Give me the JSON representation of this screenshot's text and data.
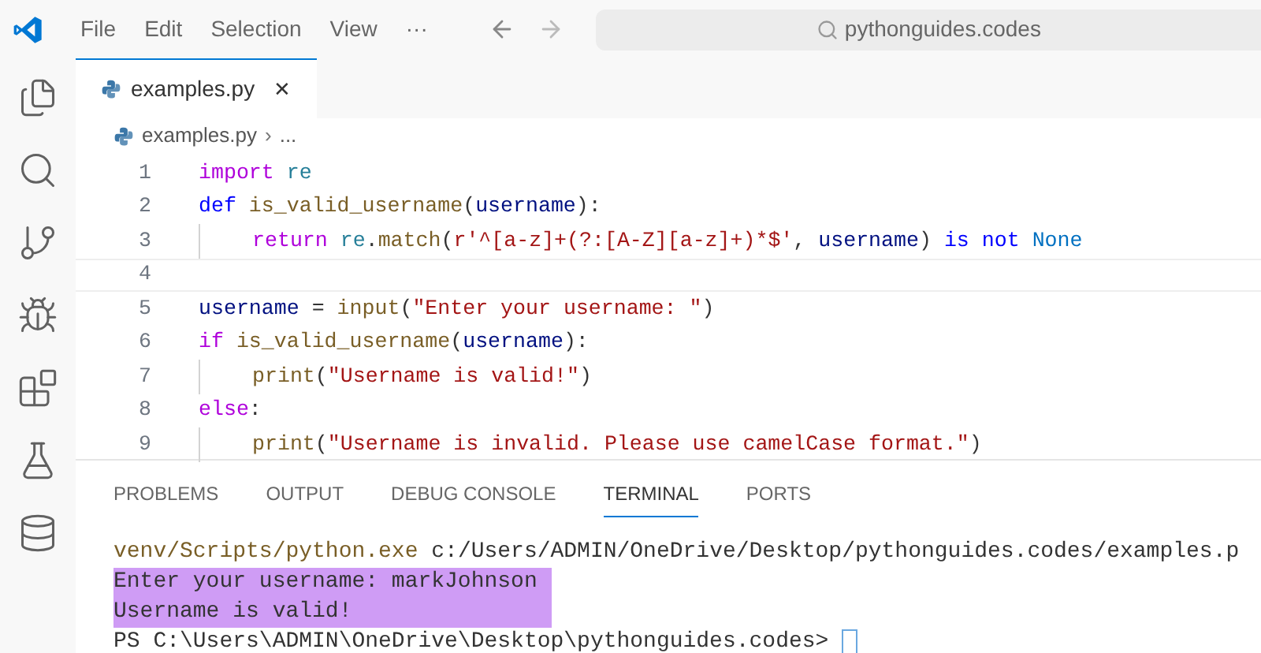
{
  "menu": [
    "File",
    "Edit",
    "Selection",
    "View",
    "···"
  ],
  "search": {
    "value": "pythonguides.codes"
  },
  "tabs": [
    {
      "label": "examples.py",
      "selected": true,
      "close": "✕"
    }
  ],
  "breadcrumb": {
    "file": "examples.py",
    "separator": "›",
    "rest": "..."
  },
  "code_lines": [
    {
      "number": "1",
      "indent": false,
      "current": false,
      "tokens": [
        {
          "kind": "control",
          "text": "import"
        },
        {
          "kind": "module",
          "text": " re"
        }
      ]
    },
    {
      "number": "2",
      "indent": false,
      "current": false,
      "tokens": [
        {
          "kind": "keyword",
          "text": "def"
        },
        {
          "kind": "function",
          "text": " is_valid_username"
        },
        {
          "kind": "plain",
          "text": "("
        },
        {
          "kind": "variable",
          "text": "username"
        },
        {
          "kind": "plain",
          "text": "):"
        }
      ]
    },
    {
      "number": "3",
      "indent": true,
      "current": false,
      "tokens": [
        {
          "kind": "control",
          "text": "return"
        },
        {
          "kind": "module",
          "text": " re"
        },
        {
          "kind": "plain",
          "text": "."
        },
        {
          "kind": "function",
          "text": "match"
        },
        {
          "kind": "plain",
          "text": "("
        },
        {
          "kind": "string",
          "text": "r'^[a-z]+(?:[A-Z][a-z]+)*$'"
        },
        {
          "kind": "plain",
          "text": ", "
        },
        {
          "kind": "variable",
          "text": "username"
        },
        {
          "kind": "plain",
          "text": ") "
        },
        {
          "kind": "keyword",
          "text": "is not"
        },
        {
          "kind": "constant",
          "text": " None"
        }
      ]
    },
    {
      "number": "4",
      "current": true
    },
    {
      "number": "5",
      "indent": false,
      "current": false,
      "tokens": [
        {
          "kind": "variable",
          "text": "username"
        },
        {
          "kind": "plain",
          "text": " = "
        },
        {
          "kind": "function",
          "text": "input"
        },
        {
          "kind": "plain",
          "text": "("
        },
        {
          "kind": "string",
          "text": "\"Enter your username: \""
        },
        {
          "kind": "plain",
          "text": ")"
        }
      ]
    },
    {
      "number": "6",
      "indent": false,
      "current": false,
      "tokens": [
        {
          "kind": "control",
          "text": "if"
        },
        {
          "kind": "function",
          "text": " is_valid_username"
        },
        {
          "kind": "plain",
          "text": "("
        },
        {
          "kind": "variable",
          "text": "username"
        },
        {
          "kind": "plain",
          "text": "):"
        }
      ]
    },
    {
      "number": "7",
      "indent": true,
      "current": false,
      "tokens": [
        {
          "kind": "function",
          "text": "print"
        },
        {
          "kind": "plain",
          "text": "("
        },
        {
          "kind": "string",
          "text": "\"Username is valid!\""
        },
        {
          "kind": "plain",
          "text": ")"
        }
      ]
    },
    {
      "number": "8",
      "indent": false,
      "current": false,
      "tokens": [
        {
          "kind": "control",
          "text": "else"
        },
        {
          "kind": "plain",
          "text": ":"
        }
      ]
    },
    {
      "number": "9",
      "indent": true,
      "current": false,
      "tokens": [
        {
          "kind": "function",
          "text": "print"
        },
        {
          "kind": "plain",
          "text": "("
        },
        {
          "kind": "string",
          "text": "\"Username is invalid. Please use camelCase format.\""
        },
        {
          "kind": "plain",
          "text": ")"
        }
      ]
    }
  ],
  "panel_tabs": [
    {
      "label": "PROBLEMS",
      "selected": false
    },
    {
      "label": "OUTPUT",
      "selected": false
    },
    {
      "label": "DEBUG CONSOLE",
      "selected": false
    },
    {
      "label": "TERMINAL",
      "selected": true
    },
    {
      "label": "PORTS",
      "selected": false
    }
  ],
  "terminal": [
    {
      "highlighted": false,
      "parts": [
        {
          "kind": "command",
          "text": "venv/Scripts/python.exe"
        },
        {
          "kind": "plain",
          "text": " c:/Users/ADMIN/OneDrive/Desktop/pythonguides.codes/examples.p"
        }
      ]
    },
    {
      "highlighted": true,
      "parts": [
        {
          "kind": "plain",
          "text": "Enter your username: markJohnson"
        }
      ]
    },
    {
      "highlighted": true,
      "parts": [
        {
          "kind": "plain",
          "text": "Username is valid!"
        }
      ]
    },
    {
      "highlighted": false,
      "cursor": true,
      "parts": [
        {
          "kind": "plain",
          "text": "PS C:\\Users\\ADMIN\\OneDrive\\Desktop\\pythonguides.codes>"
        }
      ]
    }
  ]
}
